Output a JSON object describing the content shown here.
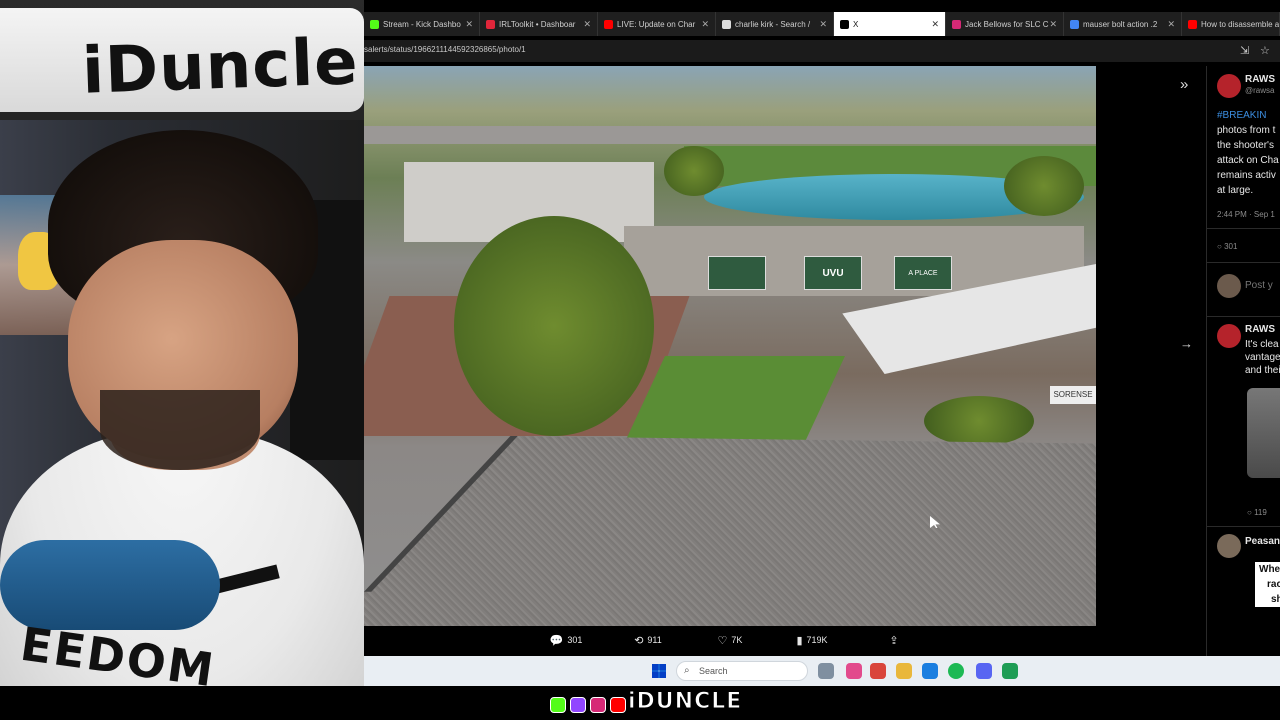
{
  "webcam": {
    "sign_text": "iDuncle",
    "shirt_text": "EEDOM"
  },
  "browser": {
    "tabs": [
      {
        "label": "Stream - Kick Dashbo",
        "fav": "kick-icon",
        "color": "#53fc18",
        "active": false
      },
      {
        "label": "IRLToolkit • Dashboar",
        "fav": "irltoolkit-icon",
        "color": "#e0263a",
        "active": false
      },
      {
        "label": "LIVE: Update on Char",
        "fav": "youtube-icon",
        "color": "#ff0000",
        "active": false
      },
      {
        "label": "charlie kirk - Search /",
        "fav": "x-icon",
        "color": "#ffffff",
        "active": false
      },
      {
        "label": "X",
        "fav": "x-icon",
        "color": "#000000",
        "active": true
      },
      {
        "label": "Jack Bellows for SLC C",
        "fav": "instagram-icon",
        "color": "#d62976",
        "active": false
      },
      {
        "label": "mauser bolt action .2",
        "fav": "google-icon",
        "color": "#4285f4",
        "active": false
      },
      {
        "label": "How to disassemble a",
        "fav": "youtube-icon",
        "color": "#ff0000",
        "active": false
      }
    ],
    "url": "salerts/status/1966211144592326865/photo/1"
  },
  "photo": {
    "sign_label": "SORENSE",
    "banner_label": "UVU",
    "banner_slogan": "A PLACE"
  },
  "actions": {
    "replies": "301",
    "reposts": "911",
    "likes": "7K",
    "views": "719K"
  },
  "timeline": {
    "post1_name": "RAWS",
    "post1_handle": "@rawsa",
    "post1_lines": [
      "#BREAKIN",
      "photos from t",
      "the shooter's",
      "attack on Cha",
      "remains activ",
      "at large."
    ],
    "post1_time": "2:44 PM · Sep 1",
    "post1_replies": "301",
    "reply_prompt": "Post y",
    "post2_name": "RAWS",
    "post2_lines": [
      "It's clea",
      "vantage",
      "and thei"
    ],
    "post2_replies": "119",
    "post3_name": "Peasant",
    "post3_lines": [
      "Wher",
      "rac",
      "sh"
    ]
  },
  "taskbar": {
    "search_label": "Search"
  },
  "overlay": {
    "stream_name": "iDUNCLE"
  }
}
